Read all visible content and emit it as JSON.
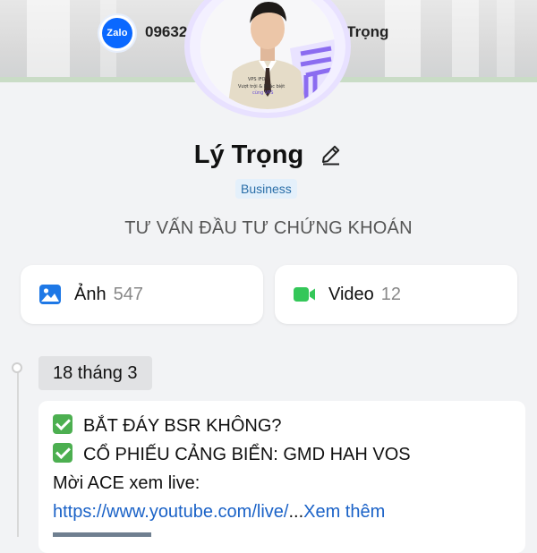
{
  "cover": {
    "phone_partial": "09632",
    "name_partial": "ý Trọng",
    "zalo_label": "Zalo"
  },
  "avatar": {
    "poster_line1": "VPS IFO",
    "poster_line2": "Vượt trội & Khác biệt",
    "poster_line3": "cùng VPS"
  },
  "profile": {
    "name": "Lý Trọng",
    "badge": "Business",
    "tagline": "TƯ VẤN ĐẦU TƯ CHỨNG KHOÁN"
  },
  "media": {
    "photos_label": "Ảnh",
    "photos_count": "547",
    "videos_label": "Video",
    "videos_count": "12"
  },
  "timeline": {
    "date": "18 tháng 3"
  },
  "post": {
    "line1": "BẮT ĐÁY BSR KHÔNG?",
    "line2": "CỔ PHIẾU CẢNG BIỂN: GMD HAH VOS",
    "line3": "Mời ACE xem live:",
    "link": "https://www.youtube.com/live/",
    "ellipsis": "...",
    "more": "Xem thêm"
  },
  "colors": {
    "zalo_blue": "#0a68ff",
    "link_blue": "#1a62c7",
    "badge_bg": "#e4f0fb",
    "check_green": "#4caf50",
    "video_green": "#34c759",
    "photo_blue": "#1e78e6"
  },
  "icons": {
    "edit": "pencil-icon",
    "photos": "image-icon",
    "videos": "video-camera-icon",
    "check": "checkmark-box-icon"
  }
}
